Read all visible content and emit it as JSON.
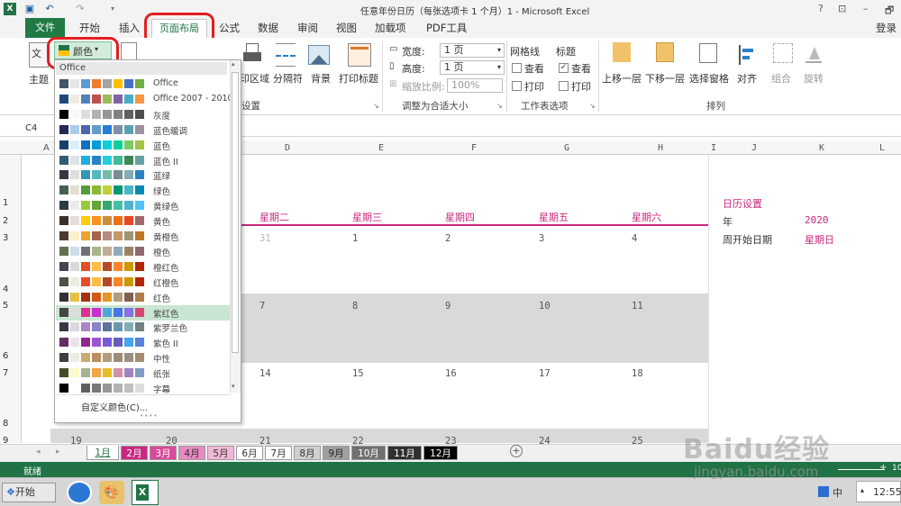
{
  "window": {
    "title": "任意年份日历（每张选项卡 1 个月）1 - Microsoft Excel",
    "help": "?",
    "minimize": "–",
    "restore": "🗗"
  },
  "tabs": {
    "file": "文件",
    "items": [
      "开始",
      "插入",
      "页面布局",
      "公式",
      "数据",
      "审阅",
      "视图",
      "加载项",
      "PDF工具"
    ],
    "active": "页面布局",
    "login": "登录"
  },
  "ribbon": {
    "theme_label": "主题",
    "colors_button": "颜色",
    "print_area": "印区域",
    "breaks": "分隔符",
    "background": "背景",
    "print_titles": "打印标题",
    "page_setup_group": "设置",
    "width_label": "宽度:",
    "width_value": "1 页",
    "height_label": "高度:",
    "height_value": "1 页",
    "scale_label": "缩放比例:",
    "scale_value": "100%",
    "scale_group": "调整为合适大小",
    "gridlines_label": "网格线",
    "headings_label": "标题",
    "view_label": "查看",
    "print_label": "打印",
    "sheet_options_group": "工作表选项",
    "bring_forward": "上移一层",
    "send_backward": "下移一层",
    "selection_pane": "选择窗格",
    "align": "对齐",
    "group": "组合",
    "rotate": "旋转",
    "arrange_group": "排列"
  },
  "formula_bar": {
    "name_box": "C4"
  },
  "sheet": {
    "columns": [
      "A",
      "D",
      "E",
      "F",
      "G",
      "H",
      "I",
      "J",
      "K",
      "L"
    ],
    "rows": [
      "1",
      "2",
      "3",
      "4",
      "5",
      "6",
      "7",
      "8",
      "9"
    ],
    "weekdays": [
      "星期二",
      "星期三",
      "星期四",
      "星期五",
      "星期六"
    ],
    "week1": [
      "31",
      "1",
      "2",
      "3",
      "4"
    ],
    "week2": [
      "7",
      "8",
      "9",
      "10",
      "11"
    ],
    "week3": [
      "14",
      "15",
      "16",
      "17",
      "18"
    ],
    "week4": [
      "19",
      "20",
      "21",
      "22",
      "23",
      "24",
      "25"
    ],
    "settings_title": "日历设置",
    "year_label": "年",
    "year_value": "2020",
    "week_start_label": "周开始日期",
    "week_start_value": "星期日"
  },
  "sheet_tabs": [
    {
      "label": "1月",
      "bg": "#ffffff",
      "fg": "#217346"
    },
    {
      "label": "2月",
      "bg": "#c8287f",
      "fg": "#ffffff"
    },
    {
      "label": "3月",
      "bg": "#d94a9a",
      "fg": "#ffffff"
    },
    {
      "label": "4月",
      "bg": "#e68ac0",
      "fg": "#333333"
    },
    {
      "label": "5月",
      "bg": "#f0b8d6",
      "fg": "#333333"
    },
    {
      "label": "6月",
      "bg": "#ffffff",
      "fg": "#333333"
    },
    {
      "label": "7月",
      "bg": "#ffffff",
      "fg": "#333333"
    },
    {
      "label": "8月",
      "bg": "#d0d0d0",
      "fg": "#333333"
    },
    {
      "label": "9月",
      "bg": "#a0a0a0",
      "fg": "#222222"
    },
    {
      "label": "10月",
      "bg": "#707070",
      "fg": "#ffffff"
    },
    {
      "label": "11月",
      "bg": "#303030",
      "fg": "#ffffff"
    },
    {
      "label": "12月",
      "bg": "#000000",
      "fg": "#ffffff"
    }
  ],
  "status": {
    "ready": "就绪",
    "zoom_plus": "+",
    "zoom_value": "10"
  },
  "taskbar": {
    "start": "开始",
    "time": "12:55",
    "ime": "中"
  },
  "dropdown": {
    "section": "Office",
    "custom_colors": "自定义颜色(C)...",
    "themes": [
      {
        "name": "Office",
        "colors": [
          "#44546a",
          "#e7e6e6",
          "#5b9bd5",
          "#ed7d31",
          "#a5a5a5",
          "#ffc000",
          "#4472c4",
          "#70ad47"
        ]
      },
      {
        "name": "Office 2007 - 2010",
        "colors": [
          "#1f497d",
          "#eeece1",
          "#4f81bd",
          "#c0504d",
          "#9bbb59",
          "#8064a2",
          "#4bacc6",
          "#f79646"
        ]
      },
      {
        "name": "灰度",
        "colors": [
          "#000000",
          "#f8f8f8",
          "#dddddd",
          "#b2b2b2",
          "#969696",
          "#808080",
          "#5f5f5f",
          "#4d4d4d"
        ]
      },
      {
        "name": "蓝色暖调",
        "colors": [
          "#242852",
          "#acccea",
          "#4a66ac",
          "#629dd1",
          "#297fd5",
          "#7f8fa9",
          "#5aa2ae",
          "#9d90a0"
        ]
      },
      {
        "name": "蓝色",
        "colors": [
          "#17406d",
          "#dbeff9",
          "#0f6fc6",
          "#009dd9",
          "#0bd0d9",
          "#10cf9b",
          "#7cca62",
          "#a5c249"
        ]
      },
      {
        "name": "蓝色 II",
        "colors": [
          "#335b74",
          "#dfe3e5",
          "#1cade4",
          "#2683c6",
          "#27ced7",
          "#42ba97",
          "#3e8853",
          "#62a39f"
        ]
      },
      {
        "name": "蓝绿",
        "colors": [
          "#373545",
          "#dedede",
          "#3494ba",
          "#58b6c0",
          "#75bda7",
          "#7a8c8e",
          "#84acb6",
          "#2683c6"
        ]
      },
      {
        "name": "绿色",
        "colors": [
          "#455f51",
          "#e3ded1",
          "#549e39",
          "#8ab833",
          "#c0cf3a",
          "#029676",
          "#4ab5c4",
          "#0989b1"
        ]
      },
      {
        "name": "黄绿色",
        "colors": [
          "#2c3c43",
          "#ebebeb",
          "#99cb38",
          "#63a537",
          "#37a76f",
          "#44c1a3",
          "#4eb3cf",
          "#51c3f9"
        ]
      },
      {
        "name": "黄色",
        "colors": [
          "#39302a",
          "#e5dedb",
          "#ffca08",
          "#f8931d",
          "#ce8d3e",
          "#ec7016",
          "#e64823",
          "#9c6a6a"
        ]
      },
      {
        "name": "黄橙色",
        "colors": [
          "#4e3b30",
          "#fbeec9",
          "#f0a22e",
          "#a5644e",
          "#b58b80",
          "#c3986d",
          "#a19574",
          "#c17529"
        ]
      },
      {
        "name": "橙色",
        "colors": [
          "#637052",
          "#ccddea",
          "#6f6f74",
          "#a7b789",
          "#beae98",
          "#92a9b9",
          "#9c8265",
          "#8d6974"
        ]
      },
      {
        "name": "橙红色",
        "colors": [
          "#454551",
          "#d8d9dc",
          "#e84c22",
          "#ffbd47",
          "#b64926",
          "#ff8427",
          "#cc9900",
          "#b22600"
        ]
      },
      {
        "name": "红橙色",
        "colors": [
          "#505046",
          "#eeece1",
          "#e84c22",
          "#ffbd47",
          "#b64926",
          "#ff8427",
          "#cc9900",
          "#b22600"
        ]
      },
      {
        "name": "红色",
        "colors": [
          "#323232",
          "#e5c243",
          "#a5300f",
          "#d55816",
          "#e19825",
          "#b19c7d",
          "#7f5f52",
          "#b27d49"
        ]
      },
      {
        "name": "紫红色",
        "colors": [
          "#454545",
          "#dddddd",
          "#e32d91",
          "#c830cc",
          "#4ea6dc",
          "#4775e7",
          "#8971e1",
          "#d54773"
        ]
      },
      {
        "name": "紫罗兰色",
        "colors": [
          "#373545",
          "#dcd8dc",
          "#ad84c6",
          "#8784c7",
          "#5d739a",
          "#6997af",
          "#84acb6",
          "#6f8183"
        ]
      },
      {
        "name": "紫色 II",
        "colors": [
          "#632e62",
          "#eae5eb",
          "#92278f",
          "#9b57d3",
          "#755dd9",
          "#665eb8",
          "#45a5ed",
          "#5982db"
        ]
      },
      {
        "name": "中性",
        "colors": [
          "#3f3f3f",
          "#eeece1",
          "#caab6f",
          "#bc8c5f",
          "#b09a7f",
          "#9b8c77",
          "#988f7f",
          "#a48d6f"
        ]
      },
      {
        "name": "纸张",
        "colors": [
          "#444d26",
          "#fefac9",
          "#a5b592",
          "#f3a447",
          "#e7bc29",
          "#d092a7",
          "#9c85c0",
          "#809ec2"
        ]
      },
      {
        "name": "字幕",
        "colors": [
          "#000000",
          "#ffffff",
          "#5f5f5f",
          "#777777",
          "#969696",
          "#b2b2b2",
          "#c0c0c0",
          "#dddddd"
        ]
      }
    ],
    "selected": "紫红色"
  },
  "watermark": {
    "brand": "Baidu经验",
    "url": "jingyan.baidu.com"
  }
}
